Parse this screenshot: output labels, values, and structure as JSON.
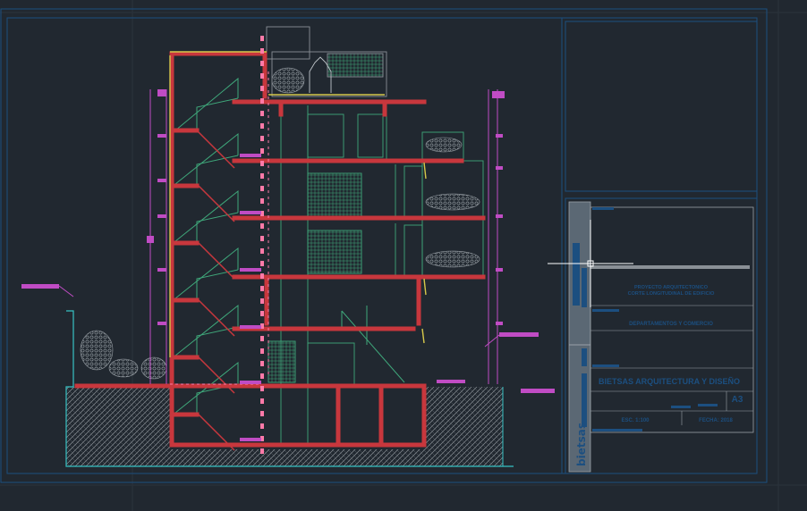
{
  "app": {
    "window_title": "",
    "background": "#212830"
  },
  "colors": {
    "frame": "#1c4f80",
    "wall_red": "#c8373d",
    "stair_green": "#3fa77a",
    "dimension_magenta": "#c04cc4",
    "fill_yellow": "#d6c84a",
    "ground_cyan": "#37c2c4",
    "pink_marker": "#ff7aa8",
    "crosshair": "#ffffff"
  },
  "title_block": {
    "brand_text": "bietsas",
    "line_project": "PROYECTO ARQUITECTONICO",
    "line_desc_1": "CORTE LONGITUDINAL DE EDIFICIO",
    "line_desc_2": "DEPARTAMENTOS Y COMERCIO",
    "line_company": "BIETSAS ARQUITECTURA Y DISEÑO",
    "sheet_no": "A3",
    "scale_label": "ESC. 1:100",
    "date_label": "FECHA: 2018"
  },
  "cursor": {
    "type": "crosshair-pickbox"
  }
}
